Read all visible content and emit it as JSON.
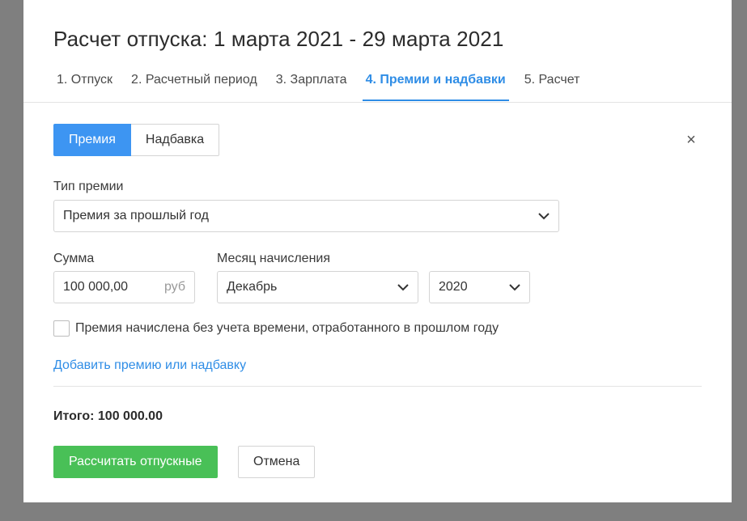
{
  "dialog": {
    "title": "Расчет отпуска: 1 марта 2021 - 29 марта 2021",
    "tabs": [
      {
        "label": "1. Отпуск",
        "active": false
      },
      {
        "label": "2. Расчетный период",
        "active": false
      },
      {
        "label": "3. Зарплата",
        "active": false
      },
      {
        "label": "4. Премии и надбавки",
        "active": true
      },
      {
        "label": "5. Расчет",
        "active": false
      }
    ]
  },
  "segment": {
    "bonus_label": "Премия",
    "allowance_label": "Надбавка",
    "close_icon": "×"
  },
  "form": {
    "bonus_type_label": "Тип премии",
    "bonus_type_value": "Премия за прошлый год",
    "amount_label": "Сумма",
    "amount_value": "100 000,00",
    "amount_suffix": "руб",
    "month_label": "Месяц начисления",
    "month_value": "Декабрь",
    "year_value": "2020",
    "checkbox_label": "Премия начислена без учета времени, отработанного в прошлом году",
    "checkbox_checked": false,
    "add_link": "Добавить премию или надбавку"
  },
  "summary": {
    "total_text": "Итого: 100 000.00"
  },
  "actions": {
    "calculate_label": "Рассчитать отпускные",
    "cancel_label": "Отмена"
  },
  "colors": {
    "accent": "#2f8de6",
    "primary_button": "#3d95f2",
    "success_button": "#49c057",
    "overlay": "#7f7f7f"
  },
  "icons": [
    "close-icon",
    "chevron-down-icon"
  ]
}
